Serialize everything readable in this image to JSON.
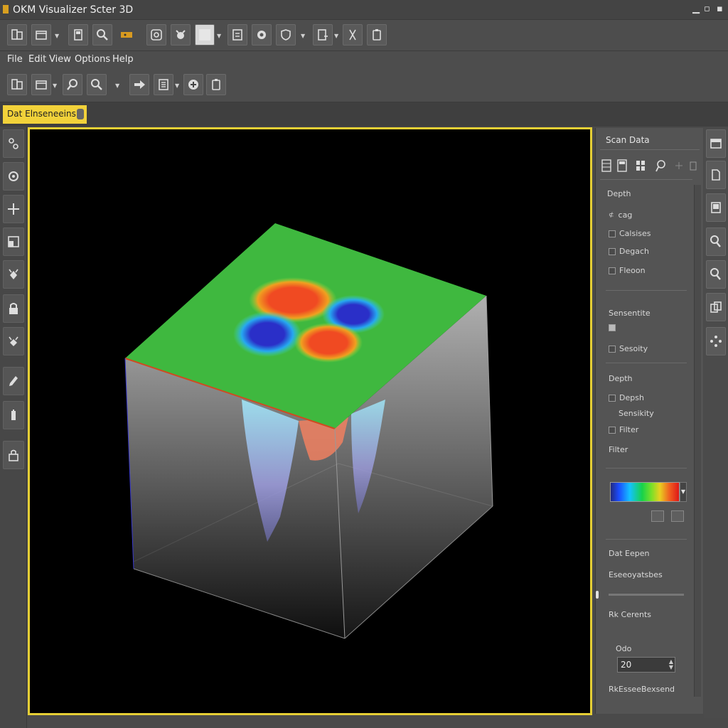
{
  "window": {
    "title": "OKM Visualizer Scter 3D"
  },
  "menu": [
    "File",
    "Edit",
    "View",
    "Options",
    "Help"
  ],
  "toolbar1_icons": [
    "new-file-icon",
    "open-folder-icon",
    "save-icon",
    "zoom-icon",
    "folder-color-icon",
    "import-icon",
    "scan-icon",
    "color-box-icon",
    "document-icon",
    "record-icon",
    "shield-icon",
    "export-icon",
    "cut-icon",
    "device-icon"
  ],
  "toolbar2_icons": [
    "new-file-icon",
    "open-folder-icon",
    "zoom-in-icon",
    "zoom-out-icon",
    "arrow-right-icon",
    "list-icon",
    "add-icon",
    "device-icon"
  ],
  "tab": {
    "label": "Dat Elnseneeins"
  },
  "panel": {
    "title": "Scan Data",
    "depth_header": "Depth",
    "checks1": [
      "cag",
      "Calsises",
      "Degach",
      "Fleoon"
    ],
    "sensitivity_header": "Sensentite",
    "sensitivity_check": "Sesoity",
    "depth_header2": "Depth",
    "checks2": [
      "Depsh",
      "Sensikity",
      "Filter"
    ],
    "filter_label": "Filter",
    "data_export": "Dat Eepen",
    "export_label": "Eseeoyatsbes",
    "rdc_label": "Rk Cerents",
    "odo_label": "Odo",
    "value": "20",
    "footer": "RkEsseeBexsend"
  },
  "colors": {
    "accent": "#e6cf35",
    "surface": "#3fb83f",
    "positive": "#f05a20",
    "negative": "#2a3fd0"
  }
}
